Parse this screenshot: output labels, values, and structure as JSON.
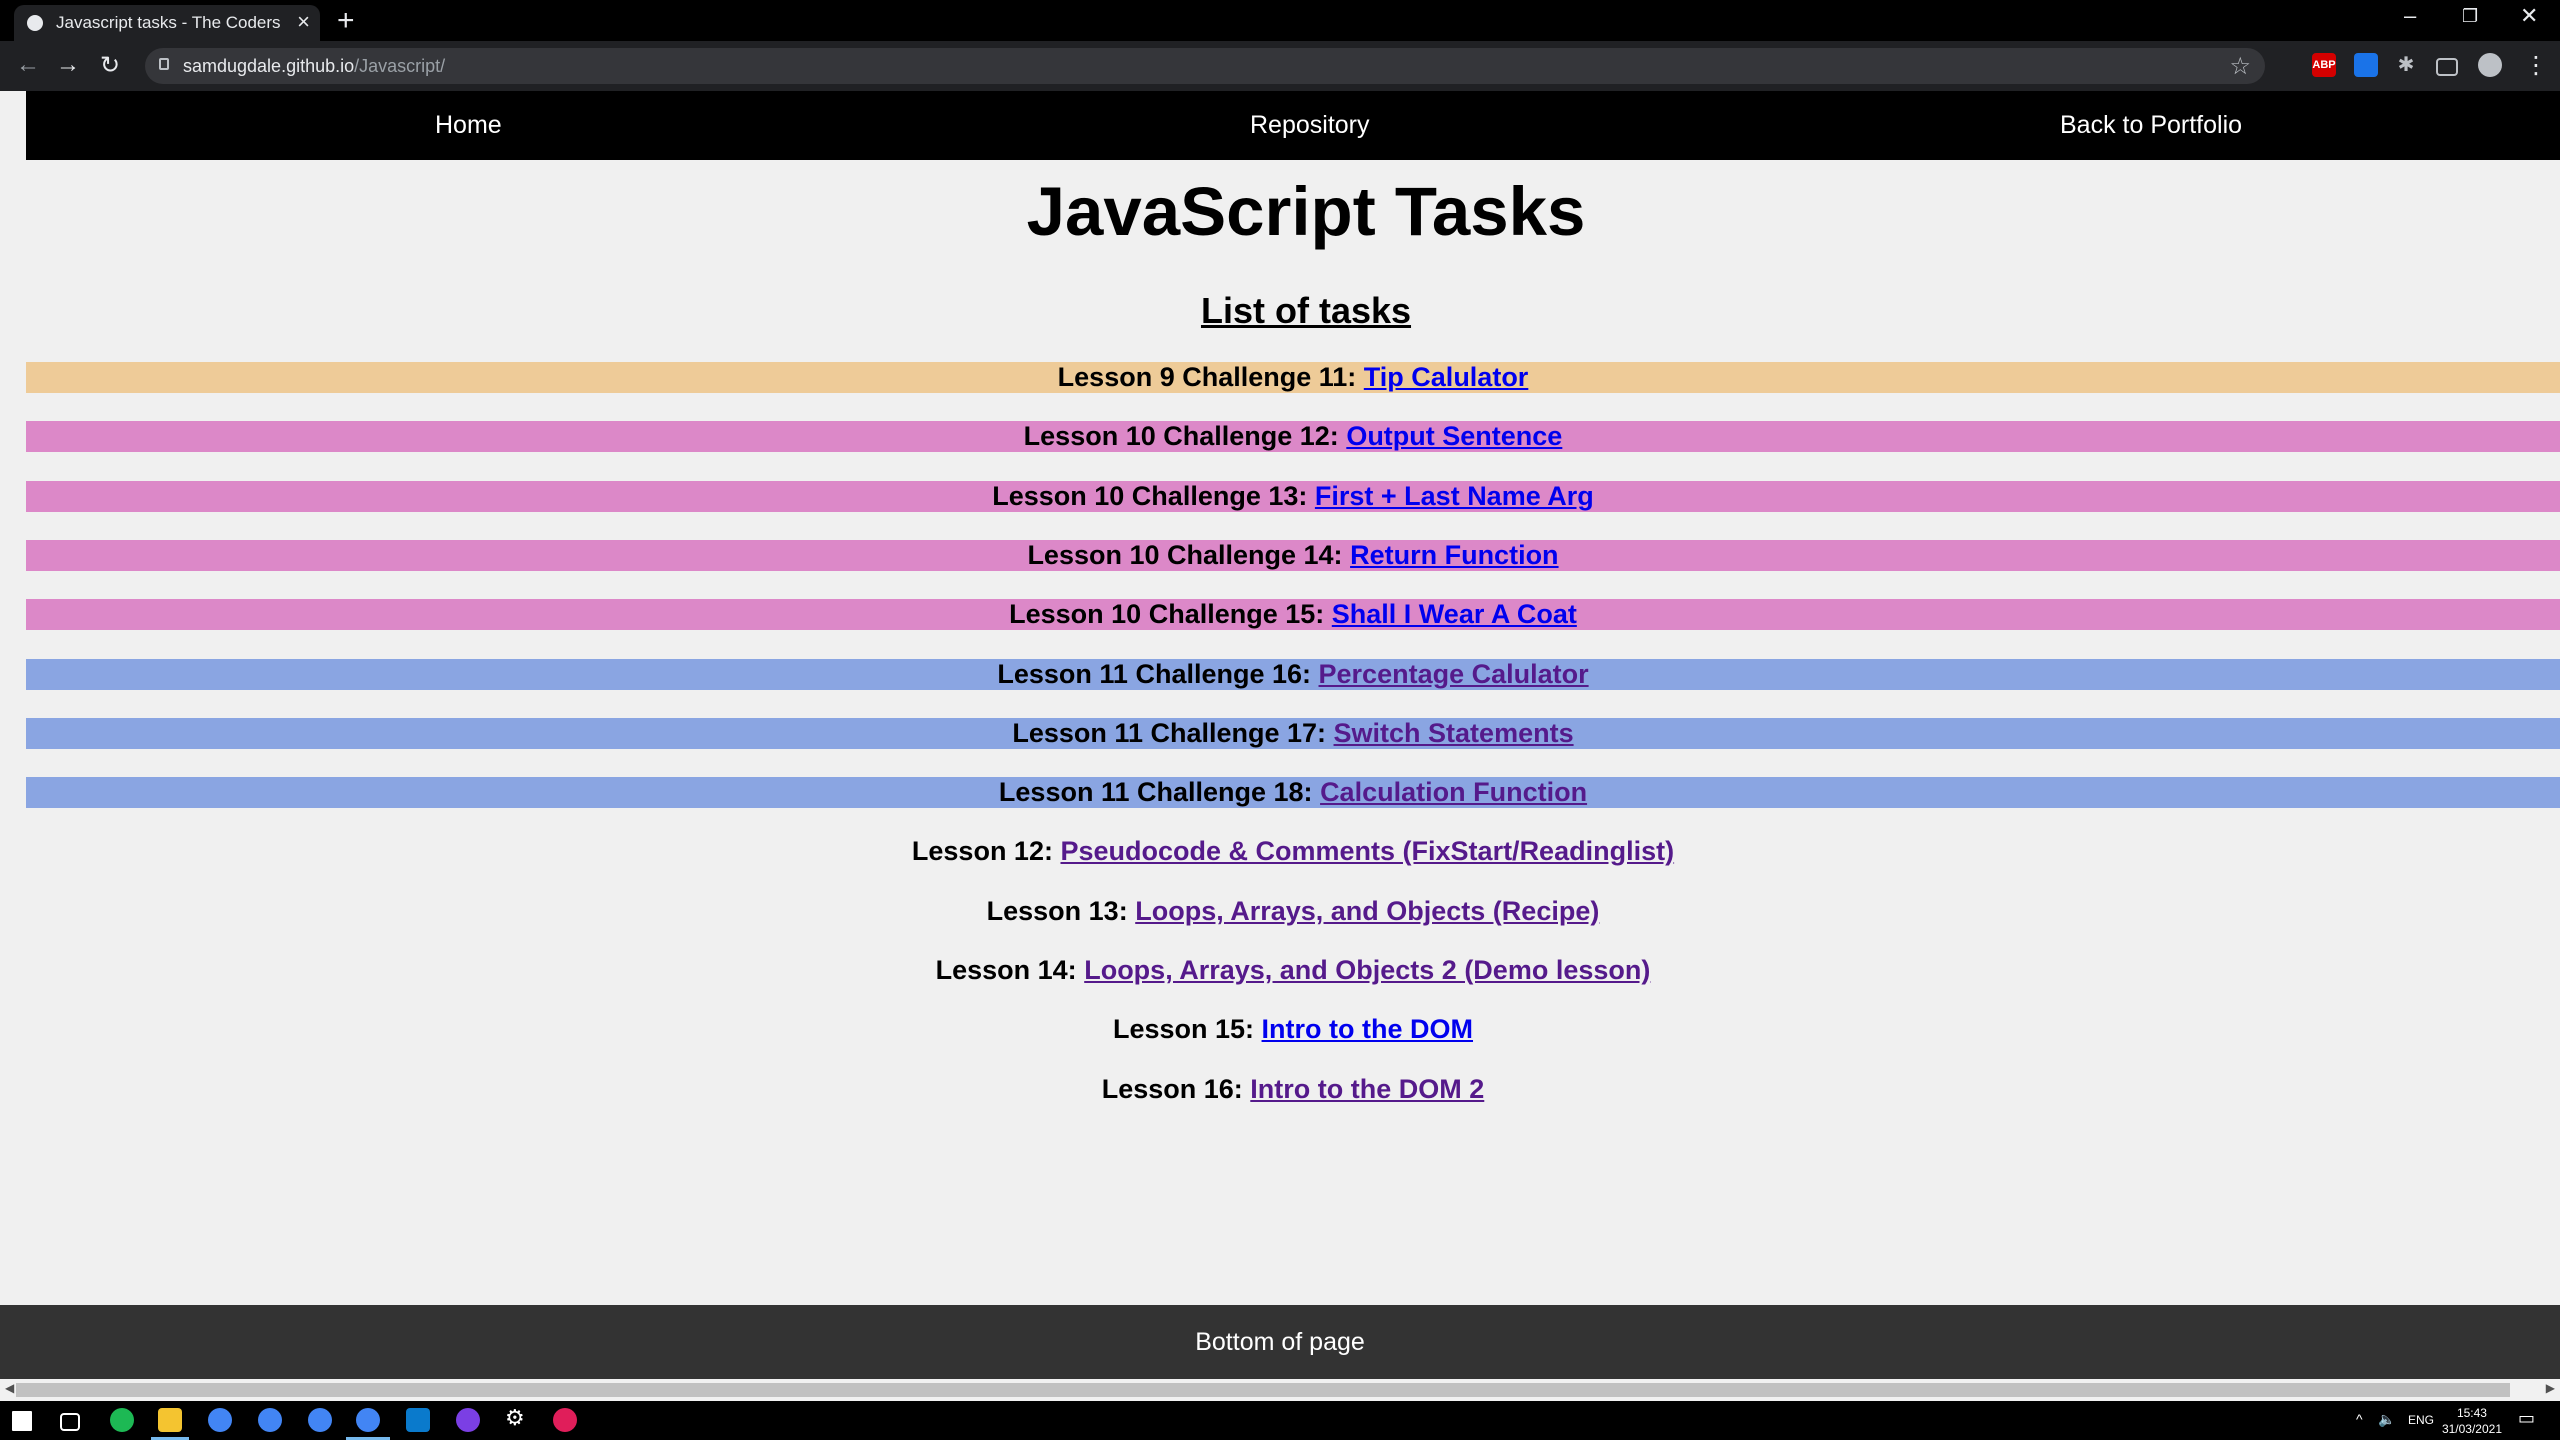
{
  "browser": {
    "tab_title": "Javascript tasks - The Coders Gui",
    "url_host": "samdugdale.github.io",
    "url_path": "/Javascript/",
    "extensions": [
      "ABP",
      "blue-square-extension",
      "puzzle-icon",
      "cast-icon",
      "avatar-icon"
    ]
  },
  "nav": {
    "home": "Home",
    "repository": "Repository",
    "portfolio": "Back to Portfolio"
  },
  "page": {
    "title": "JavaScript Tasks",
    "subtitle": "List of tasks"
  },
  "tasks": [
    {
      "label": "Lesson 9 Challenge 11:",
      "link": "Tip Calulator",
      "bg": "#eecb98",
      "visited": false
    },
    {
      "label": "Lesson 10 Challenge 12:",
      "link": "Output Sentence",
      "bg": "#dc88c8",
      "visited": false
    },
    {
      "label": "Lesson 10 Challenge 13:",
      "link": "First + Last Name Arg",
      "bg": "#dc88c8",
      "visited": false
    },
    {
      "label": "Lesson 10 Challenge 14:",
      "link": "Return Function",
      "bg": "#dc88c8",
      "visited": false
    },
    {
      "label": "Lesson 10 Challenge 15:",
      "link": "Shall I Wear A Coat",
      "bg": "#dc88c8",
      "visited": false
    },
    {
      "label": "Lesson 11 Challenge 16:",
      "link": "Percentage Calulator",
      "bg": "#8aa5e2",
      "visited": true
    },
    {
      "label": "Lesson 11 Challenge 17:",
      "link": "Switch Statements",
      "bg": "#8aa5e2",
      "visited": true
    },
    {
      "label": "Lesson 11 Challenge 18:",
      "link": "Calculation Function",
      "bg": "#8aa5e2",
      "visited": true
    },
    {
      "label": "Lesson 12:",
      "link": "Pseudocode & Comments (FixStart/Readinglist)",
      "bg": "transparent",
      "visited": true
    },
    {
      "label": "Lesson 13:",
      "link": "Loops, Arrays, and Objects (Recipe)",
      "bg": "transparent",
      "visited": true
    },
    {
      "label": "Lesson 14:",
      "link": "Loops, Arrays, and Objects 2 (Demo lesson)",
      "bg": "transparent",
      "visited": true
    },
    {
      "label": "Lesson 15:",
      "link": "Intro to the DOM",
      "bg": "transparent",
      "visited": false
    },
    {
      "label": "Lesson 16:",
      "link": "Intro to the DOM 2",
      "bg": "transparent",
      "visited": true
    }
  ],
  "footer": {
    "text": "Bottom of page"
  },
  "taskbar": {
    "lang": "ENG",
    "time": "15:43",
    "date": "31/03/2021"
  }
}
